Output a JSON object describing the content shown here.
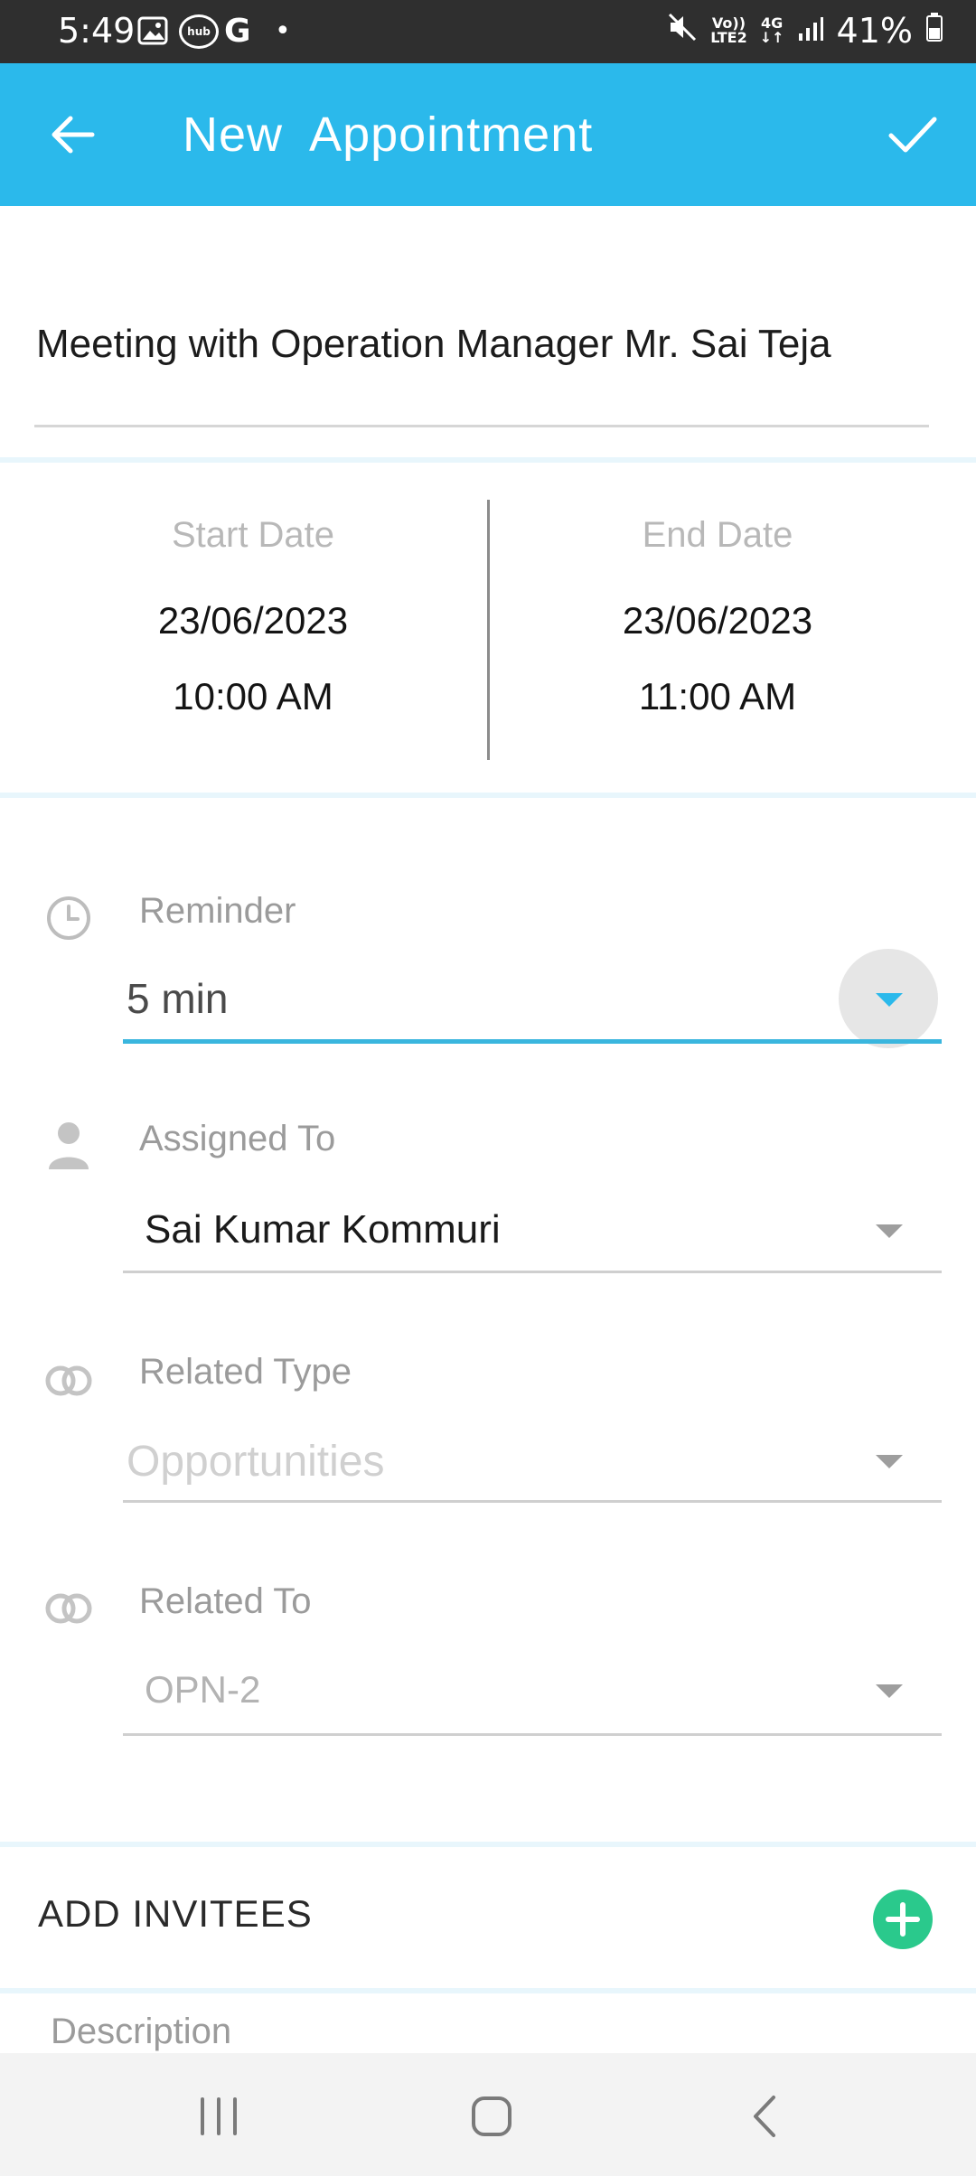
{
  "status_bar": {
    "time": "5:49",
    "hub_text": "hub",
    "g_text": "G",
    "dot": "•",
    "volte_top": "Vo))",
    "volte_bottom": "LTE2",
    "network": "4G",
    "battery": "41%",
    "icons": [
      "gallery-icon",
      "hub-icon",
      "google-icon",
      "mute-icon",
      "signal-icon",
      "battery-icon"
    ]
  },
  "app_bar": {
    "title": "New  Appointment",
    "back_icon": "arrow-left-icon",
    "save_icon": "check-icon"
  },
  "subject": {
    "value": "Meeting with Operation Manager Mr. Sai Teja"
  },
  "dates": {
    "start": {
      "label": "Start Date",
      "date": "23/06/2023",
      "time": "10:00 AM"
    },
    "end": {
      "label": "End Date",
      "date": "23/06/2023",
      "time": "11:00 AM"
    }
  },
  "fields": {
    "reminder": {
      "label": "Reminder",
      "value": "5 min",
      "icon": "clock-icon"
    },
    "assigned_to": {
      "label": "Assigned To",
      "value": "Sai Kumar Kommuri",
      "icon": "person-icon"
    },
    "related_type": {
      "label": "Related Type",
      "placeholder": "Opportunities",
      "icon": "link-icon"
    },
    "related_to": {
      "label": "Related To",
      "value": "OPN-2",
      "icon": "link-icon"
    }
  },
  "invitees": {
    "label": "ADD INVITEES",
    "icon": "plus-icon"
  },
  "description": {
    "label": "Description"
  },
  "colors": {
    "accent": "#2bb9eb",
    "add": "#2ac98c",
    "status_bar": "#2f2f2f"
  }
}
